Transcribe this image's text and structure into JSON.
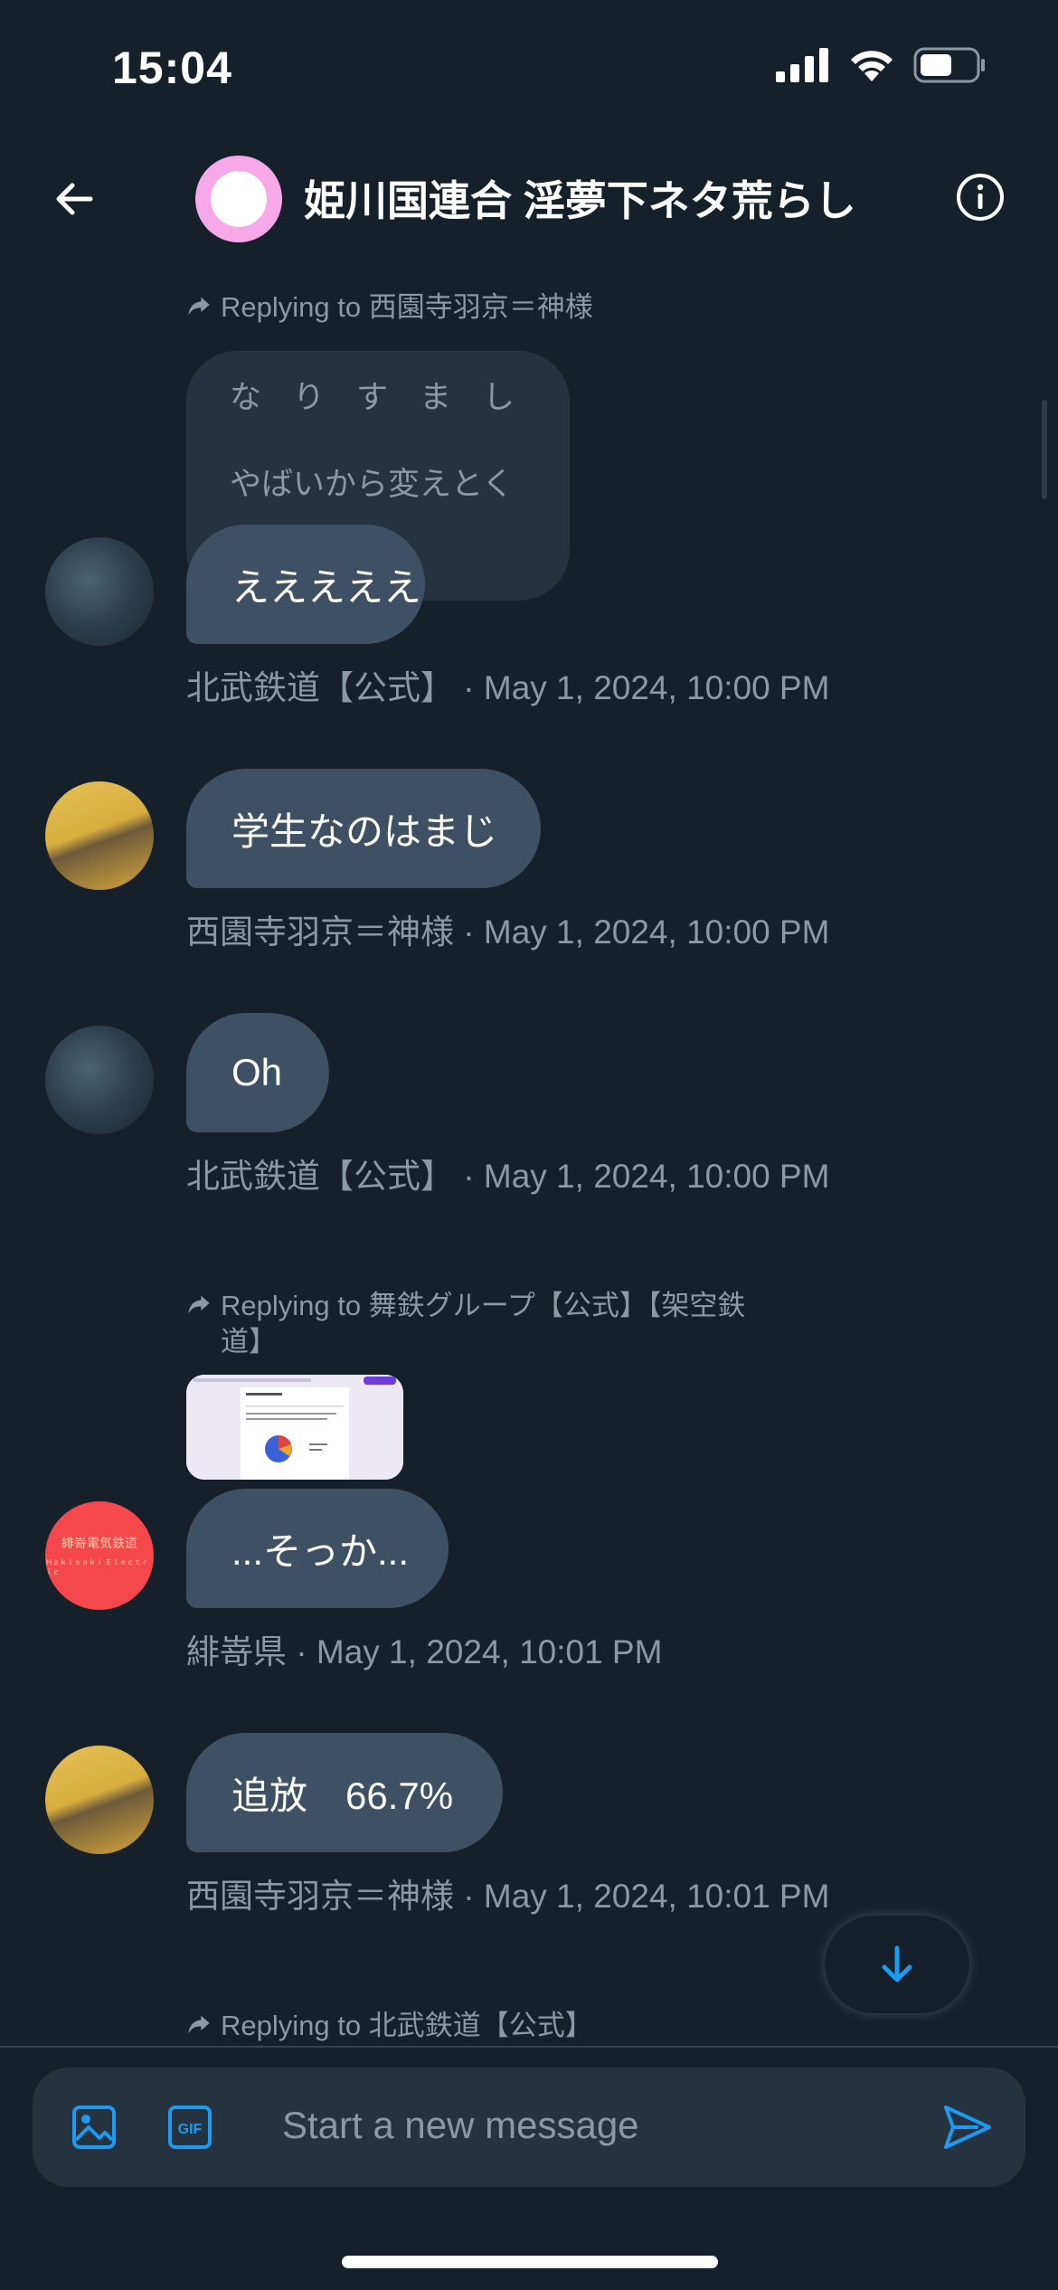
{
  "status_bar": {
    "time": "15:04"
  },
  "header": {
    "title": "姫川国連合 淫夢下ネタ荒らし"
  },
  "messages": [
    {
      "reply_to": "Replying to 西園寺羽京＝神様",
      "quoted_lines": [
        "な　り　す　ま　し",
        "やばいから変えとく"
      ],
      "text": "えええええ",
      "meta": "北武鉄道【公式】 · May 1, 2024, 10:00 PM"
    },
    {
      "text": "学生なのはまじ",
      "meta": "西園寺羽京＝神様 · May 1, 2024, 10:00 PM"
    },
    {
      "text": "Oh",
      "meta": "北武鉄道【公式】 · May 1, 2024, 10:00 PM"
    },
    {
      "reply_to_line1": "Replying to 舞鉄グループ【公式】【架空鉄",
      "reply_to_line2": "道】",
      "text": "...そっか...",
      "meta": "緋嵜県 · May 1, 2024, 10:01 PM"
    },
    {
      "text": "追放　66.7%",
      "meta": "西園寺羽京＝神様 · May 1, 2024, 10:01 PM"
    },
    {
      "reply_to": "Replying to 北武鉄道【公式】"
    }
  ],
  "avatar_text": {
    "line1": "緋嵜電気鉄道",
    "line2": "Ｈａｋｉｓａｋｉ Ｅｌｅｃｔｒｉｃ"
  },
  "composer": {
    "placeholder": "Start a new message",
    "gif_label": "GIF"
  },
  "colors": {
    "background": "#15202b",
    "bubble": "#3e5164",
    "accent": "#1d9bf0",
    "meta": "#8b98a5"
  }
}
